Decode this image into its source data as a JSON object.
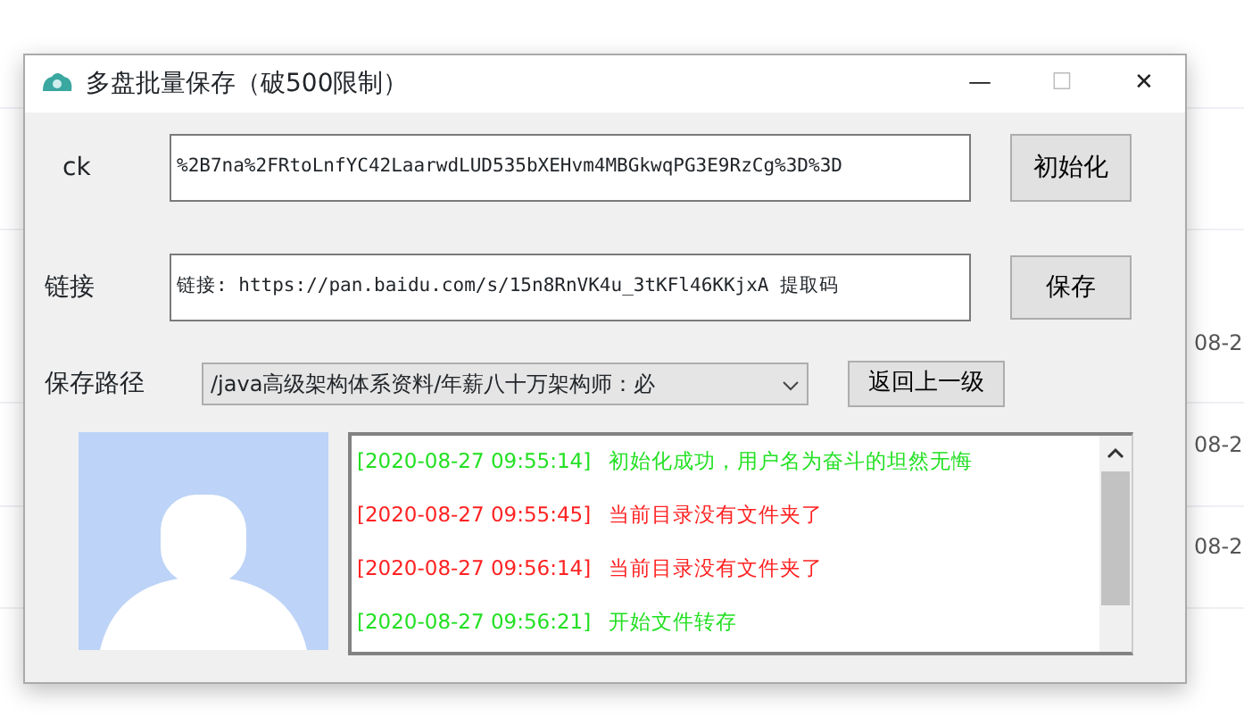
{
  "background": {
    "dates": [
      "08-2",
      "08-2",
      "08-2"
    ]
  },
  "window": {
    "title": "多盘批量保存（破500限制）",
    "controls": [
      "—",
      "☐",
      "✕"
    ]
  },
  "ck": {
    "label": "ck",
    "value": "%2B7na%2FRtoLnfYC42LaarwdLUD535bXEHvm4MBGkwqPG3E9RzCg%3D%3D",
    "button": "初始化"
  },
  "link": {
    "label": "链接",
    "value": "链接: https://pan.baidu.com/s/15n8RnVK4u_3tKFl46KKjxA 提取码",
    "button": "保存"
  },
  "save_path": {
    "label": "保存路径",
    "value": "/java高级架构体系资料/年薪八十万架构师：必",
    "button": "返回上一级"
  },
  "log": [
    {
      "time": "[2020-08-27 09:55:14]",
      "message": "初始化成功，用户名为奋斗的坦然无悔",
      "color": "#22e022"
    },
    {
      "time": "[2020-08-27 09:55:45]",
      "message": "当前目录没有文件夹了",
      "color": "#ff2222"
    },
    {
      "time": "[2020-08-27 09:56:14]",
      "message": "当前目录没有文件夹了",
      "color": "#ff2222"
    },
    {
      "time": "[2020-08-27 09:56:21]",
      "message": "开始文件转存",
      "color": "#22e022"
    }
  ]
}
